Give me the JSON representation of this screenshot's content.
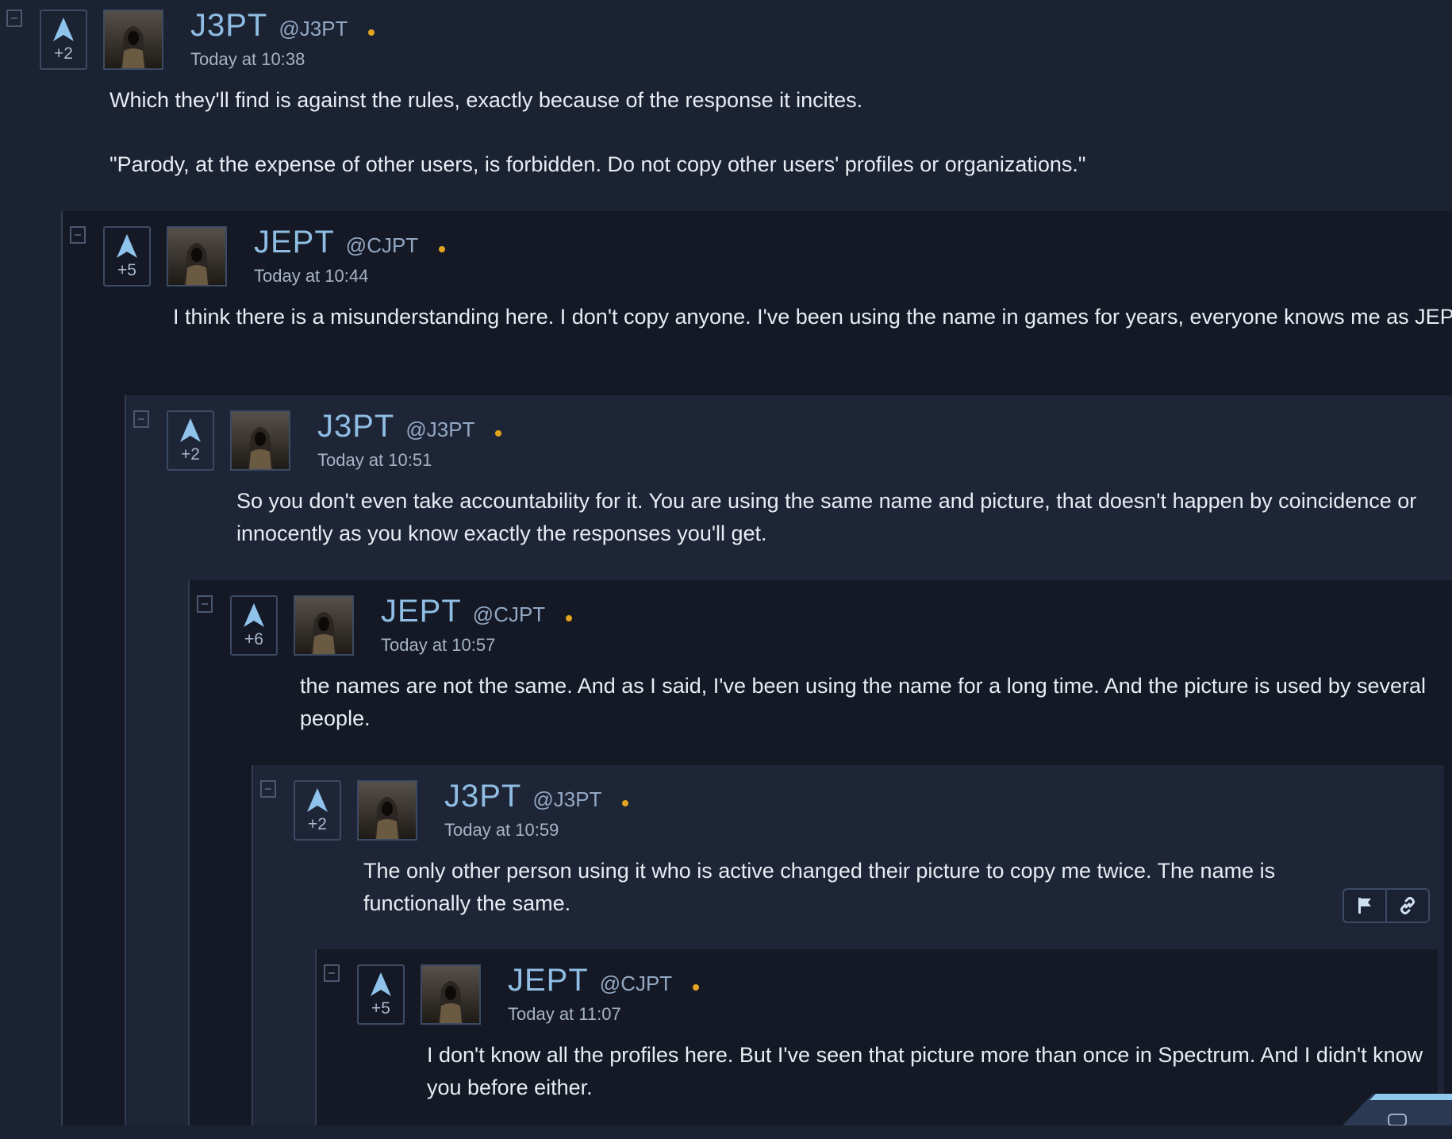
{
  "colors": {
    "name": "#8fbde3",
    "online": "#e3a51f",
    "vote_arrow": "#8fc3ec"
  },
  "comments": [
    {
      "author": "J3PT",
      "handle": "@J3PT",
      "time": "Today at 10:38",
      "votes": "+2",
      "online": true,
      "paragraphs": [
        "Which they'll find is against the rules, exactly because of the response it incites.",
        "\"Parody, at the expense of other users, is forbidden. Do not copy other users' profiles or organizations.\""
      ]
    },
    {
      "author": "JEPT",
      "handle": "@CJPT",
      "time": "Today at 10:44",
      "votes": "+5",
      "online": true,
      "paragraphs": [
        "I think there is a misunderstanding here. I don't copy anyone. I've been using the name in games for years, everyone knows me as JEPT."
      ]
    },
    {
      "author": "J3PT",
      "handle": "@J3PT",
      "time": "Today at 10:51",
      "votes": "+2",
      "online": true,
      "paragraphs": [
        "So you don't even take accountability for it. You are using the same name and picture, that doesn't happen by coincidence or innocently as you know exactly the responses you'll get."
      ]
    },
    {
      "author": "JEPT",
      "handle": "@CJPT",
      "time": "Today at 10:57",
      "votes": "+6",
      "online": true,
      "paragraphs": [
        "the names are not the same. And as I said, I've been using the name for a long time. And the picture is used by several people."
      ]
    },
    {
      "author": "J3PT",
      "handle": "@J3PT",
      "time": "Today at 10:59",
      "votes": "+2",
      "online": true,
      "paragraphs": [
        "The only other person using it who is active changed their picture to copy me twice. The name is functionally the same."
      ]
    },
    {
      "author": "JEPT",
      "handle": "@CJPT",
      "time": "Today at 11:07",
      "votes": "+5",
      "online": true,
      "paragraphs": [
        "I don't know all the profiles here. But I've seen that picture more than once in Spectrum. And I didn't know you before either."
      ]
    }
  ],
  "icons": {
    "vote": "upvote-arrow-icon",
    "collapse": "collapse-bracket-icon",
    "report": "flag-icon",
    "link": "link-icon"
  }
}
